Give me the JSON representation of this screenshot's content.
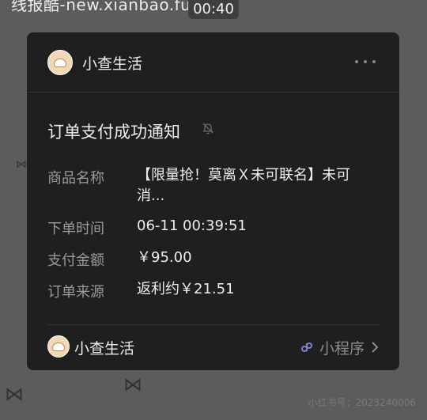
{
  "background": {
    "title": "线报酷-new.xianbao.fun",
    "time": "00:40",
    "watermark": "小红书号：2023240006"
  },
  "card": {
    "header": {
      "account_name": "小查生活",
      "more_icon": "more-dots-icon"
    },
    "notice_title": "订单支付成功通知",
    "rows": [
      {
        "label": "商品名称",
        "value": "【限量抢！莫离Ｘ未可联名】未可消..."
      },
      {
        "label": "下单时间",
        "value": "06-11 00:39:51"
      },
      {
        "label": "支付金额",
        "value": "￥95.00"
      },
      {
        "label": "订单来源",
        "value": "返利约￥21.51"
      }
    ],
    "footer": {
      "account_name": "小查生活",
      "mini_program_label": "小程序"
    }
  },
  "colors": {
    "card_bg": "#1f1f1f",
    "page_bg": "#5c5c5c",
    "link_icon": "#7b86c9"
  }
}
